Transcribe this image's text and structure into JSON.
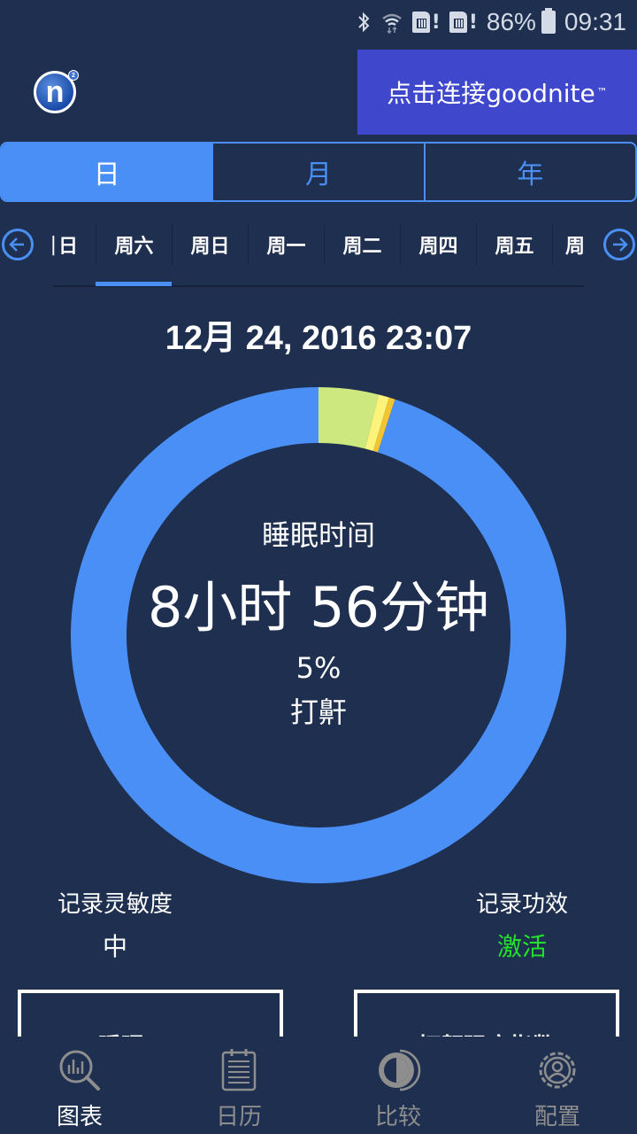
{
  "status_bar": {
    "icons": [
      "bluetooth-icon",
      "wifi-icon",
      "sim1-alert-icon",
      "sim2-alert-icon",
      "battery-icon"
    ],
    "battery_percent": "86%",
    "time": "09:31"
  },
  "header": {
    "logo_icon": "n2-logo-icon",
    "connect_label": "点击连接goodnite",
    "connect_trademark": "™",
    "accent_color": "#3f48cc"
  },
  "range_tabs": {
    "items": [
      {
        "label": "日",
        "active": true
      },
      {
        "label": "月",
        "active": false
      },
      {
        "label": "年",
        "active": false
      }
    ],
    "accent_color": "#4a8ff5"
  },
  "day_scroller": {
    "prev_icon": "arrow-left-circle-icon",
    "next_icon": "arrow-right-circle-icon",
    "items": [
      {
        "label": "日",
        "partial": "left"
      },
      {
        "label": "周六",
        "active": true
      },
      {
        "label": "周日"
      },
      {
        "label": "周一"
      },
      {
        "label": "周二"
      },
      {
        "label": "周四"
      },
      {
        "label": "周五"
      },
      {
        "label": "周",
        "partial": "right"
      }
    ]
  },
  "record": {
    "date": "12月 24, 2016 23:07"
  },
  "chart_data": {
    "type": "pie",
    "title": "睡眠时间",
    "donut": true,
    "start_angle": "top",
    "slices": [
      {
        "name": "segment-green",
        "fraction": 0.039,
        "color": "#cde87f"
      },
      {
        "name": "segment-light-yellow",
        "fraction": 0.007,
        "color": "#fbf37a"
      },
      {
        "name": "segment-amber",
        "fraction": 0.004,
        "color": "#f2c531"
      },
      {
        "name": "segment-blue",
        "fraction": 0.95,
        "color": "#4a8ff5"
      }
    ],
    "center_text": {
      "label": "睡眠时间",
      "value": "8小时 56分钟",
      "snore_percent": "5%",
      "snore_label": "打鼾"
    }
  },
  "info": {
    "sensitivity_label": "记录灵敏度",
    "sensitivity_value": "中",
    "efficacy_label": "记录功效",
    "efficacy_value": "激活",
    "efficacy_color": "#22e32a"
  },
  "cards": [
    {
      "title": "睡眠note"
    },
    {
      "title": "打鼾强度指数"
    }
  ],
  "bottom_nav": {
    "items": [
      {
        "label": "图表",
        "icon": "chart-search-icon",
        "active": true
      },
      {
        "label": "日历",
        "icon": "calendar-notepad-icon",
        "active": false
      },
      {
        "label": "比较",
        "icon": "compare-icon",
        "active": false
      },
      {
        "label": "配置",
        "icon": "settings-profile-icon",
        "active": false
      }
    ]
  }
}
